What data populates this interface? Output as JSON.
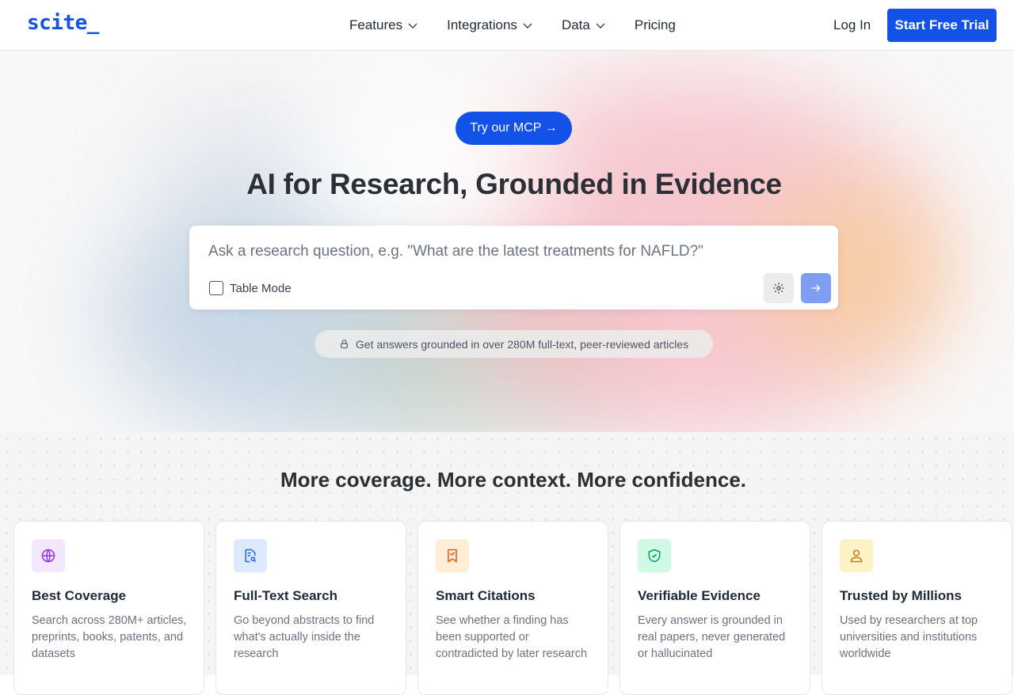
{
  "nav": {
    "logo": "scite_",
    "links": [
      {
        "label": "Features",
        "has_dropdown": true
      },
      {
        "label": "Integrations",
        "has_dropdown": true
      },
      {
        "label": "Data",
        "has_dropdown": true
      },
      {
        "label": "Pricing",
        "has_dropdown": false
      }
    ],
    "login": "Log In",
    "trial": "Start Free Trial"
  },
  "hero": {
    "mcp_button": "Try our MCP →",
    "title": "AI for Research, Grounded in Evidence",
    "search_placeholder": "Ask a research question, e.g. \"What are the latest treatments for NAFLD?\"",
    "table_mode_label": "Table Mode",
    "info_pill": "Get answers grounded in over 280M full-text, peer-reviewed articles"
  },
  "features": {
    "title": "More coverage. More context. More confidence.",
    "cards": [
      {
        "icon": "globe-icon",
        "title": "Best Coverage",
        "desc": "Search across 280M+ articles, preprints, books, patents, and datasets",
        "icon_bg": "#f3e8ff",
        "icon_color": "#9333ea"
      },
      {
        "icon": "document-search-icon",
        "title": "Full-Text Search",
        "desc": "Go beyond abstracts to find what's actually inside the research",
        "icon_bg": "#dbeafe",
        "icon_color": "#2563eb"
      },
      {
        "icon": "bookmark-icon",
        "title": "Smart Citations",
        "desc": "See whether a finding has been supported or contradicted by later research",
        "icon_bg": "#ffedd5",
        "icon_color": "#ea580c"
      },
      {
        "icon": "shield-check-icon",
        "title": "Verifiable Evidence",
        "desc": "Every answer is grounded in real papers, never generated or hallucinated",
        "icon_bg": "#d1fae5",
        "icon_color": "#059669"
      },
      {
        "icon": "user-icon",
        "title": "Trusted by Millions",
        "desc": "Used by researchers at top universities and institutions worldwide",
        "icon_bg": "#fef3c7",
        "icon_color": "#d97706"
      }
    ]
  },
  "colors": {
    "brand": "#1252e8",
    "send_button": "#7d9ef2"
  }
}
